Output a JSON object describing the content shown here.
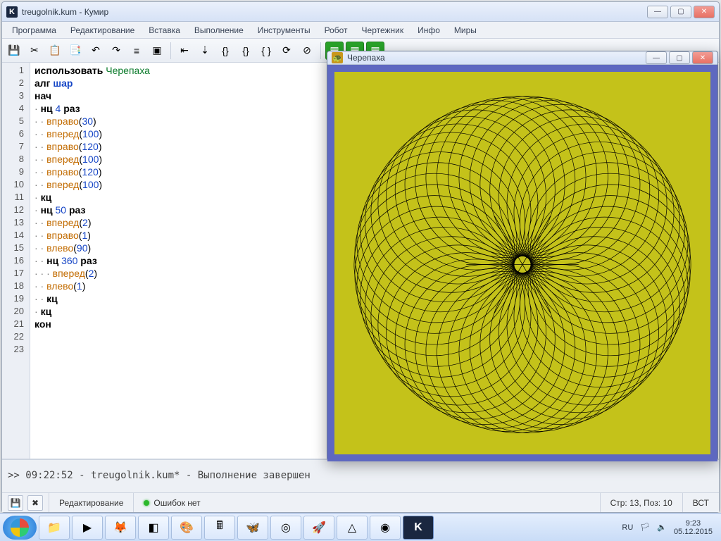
{
  "window": {
    "title": "treugolnik.kum - Кумир",
    "min": "—",
    "max": "▢",
    "close": "✕"
  },
  "menu": [
    "Программа",
    "Редактирование",
    "Вставка",
    "Выполнение",
    "Инструменты",
    "Робот",
    "Чертежник",
    "Инфо",
    "Миры"
  ],
  "code": {
    "lines": 23,
    "src": [
      {
        "t": [
          [
            "kw",
            "использовать "
          ],
          [
            "mod",
            "Черепаха"
          ]
        ]
      },
      {
        "t": [
          [
            "kw",
            "алг "
          ],
          [
            "name",
            "шар"
          ]
        ]
      },
      {
        "t": [
          [
            "kw",
            "нач"
          ]
        ]
      },
      {
        "t": [
          [
            "dot",
            "· "
          ],
          [
            "kw",
            "нц "
          ],
          [
            "num",
            "4"
          ],
          [
            "kw",
            " раз"
          ]
        ]
      },
      {
        "t": [
          [
            "dot",
            "· · "
          ],
          [
            "fn",
            "вправо"
          ],
          [
            "",
            "("
          ],
          [
            "num",
            "30"
          ],
          [
            "",
            ")"
          ]
        ]
      },
      {
        "t": [
          [
            "dot",
            "· · "
          ],
          [
            "fn",
            "вперед"
          ],
          [
            "",
            "("
          ],
          [
            "num",
            "100"
          ],
          [
            "",
            ")"
          ]
        ]
      },
      {
        "t": [
          [
            "dot",
            "· · "
          ],
          [
            "fn",
            "вправо"
          ],
          [
            "",
            "("
          ],
          [
            "num",
            "120"
          ],
          [
            "",
            ")"
          ]
        ]
      },
      {
        "t": [
          [
            "dot",
            "· · "
          ],
          [
            "fn",
            "вперед"
          ],
          [
            "",
            "("
          ],
          [
            "num",
            "100"
          ],
          [
            "",
            ")"
          ]
        ]
      },
      {
        "t": [
          [
            "dot",
            "· · "
          ],
          [
            "fn",
            "вправо"
          ],
          [
            "",
            "("
          ],
          [
            "num",
            "120"
          ],
          [
            "",
            ")"
          ]
        ]
      },
      {
        "t": [
          [
            "dot",
            "· · "
          ],
          [
            "fn",
            "вперед"
          ],
          [
            "",
            "("
          ],
          [
            "num",
            "100"
          ],
          [
            "",
            ")"
          ]
        ]
      },
      {
        "t": [
          [
            "dot",
            "· "
          ],
          [
            "kw",
            "кц"
          ]
        ]
      },
      {
        "t": [
          [
            "dot",
            "· "
          ],
          [
            "kw",
            "нц "
          ],
          [
            "num",
            "50"
          ],
          [
            "kw",
            " раз"
          ]
        ]
      },
      {
        "t": [
          [
            "dot",
            "· · "
          ],
          [
            "fn",
            "вперед"
          ],
          [
            "",
            "("
          ],
          [
            "num",
            "2"
          ],
          [
            "",
            ")"
          ]
        ]
      },
      {
        "t": [
          [
            "dot",
            "· · "
          ],
          [
            "fn",
            "вправо"
          ],
          [
            "",
            "("
          ],
          [
            "num",
            "1"
          ],
          [
            "",
            ")"
          ]
        ]
      },
      {
        "t": [
          [
            "dot",
            "· · "
          ],
          [
            "fn",
            "влево"
          ],
          [
            "",
            "("
          ],
          [
            "num",
            "90"
          ],
          [
            "",
            ")"
          ]
        ]
      },
      {
        "t": [
          [
            "dot",
            "· · "
          ],
          [
            "kw",
            "нц "
          ],
          [
            "num",
            "360"
          ],
          [
            "kw",
            " раз"
          ]
        ]
      },
      {
        "t": [
          [
            "dot",
            "· · · "
          ],
          [
            "fn",
            "вперед"
          ],
          [
            "",
            "("
          ],
          [
            "num",
            "2"
          ],
          [
            "",
            ")"
          ]
        ]
      },
      {
        "t": [
          [
            "dot",
            "· · "
          ],
          [
            "fn",
            "влево"
          ],
          [
            "",
            "("
          ],
          [
            "num",
            "1"
          ],
          [
            "",
            ")"
          ]
        ]
      },
      {
        "t": [
          [
            "dot",
            "· · "
          ],
          [
            "kw",
            "кц"
          ]
        ]
      },
      {
        "t": [
          [
            "dot",
            "· "
          ],
          [
            "kw",
            "кц"
          ]
        ]
      },
      {
        "t": [
          [
            "kw",
            "кон"
          ]
        ]
      },
      {
        "t": [
          [
            "",
            ""
          ]
        ]
      },
      {
        "t": [
          [
            "",
            ""
          ]
        ]
      }
    ]
  },
  "console": ">> 09:22:52 - treugolnik.kum* - Выполнение завершен",
  "status": {
    "mode": "Редактирование",
    "errors": "Ошибок нет",
    "pos": "Стр: 13, Поз: 10",
    "ins": "ВСТ"
  },
  "turtle": {
    "title": "Черепаха"
  },
  "tray": {
    "lang": "RU",
    "time": "9:23",
    "date": "05.12.2015"
  },
  "toolbar_icons": [
    "💾",
    "✂",
    "📋",
    "📑",
    "↶",
    "↷",
    "≡",
    "▣"
  ],
  "toolbar_run": [
    "⇤",
    "⇣",
    "{}",
    "{}",
    "{ }",
    "⟳",
    "⊘"
  ]
}
